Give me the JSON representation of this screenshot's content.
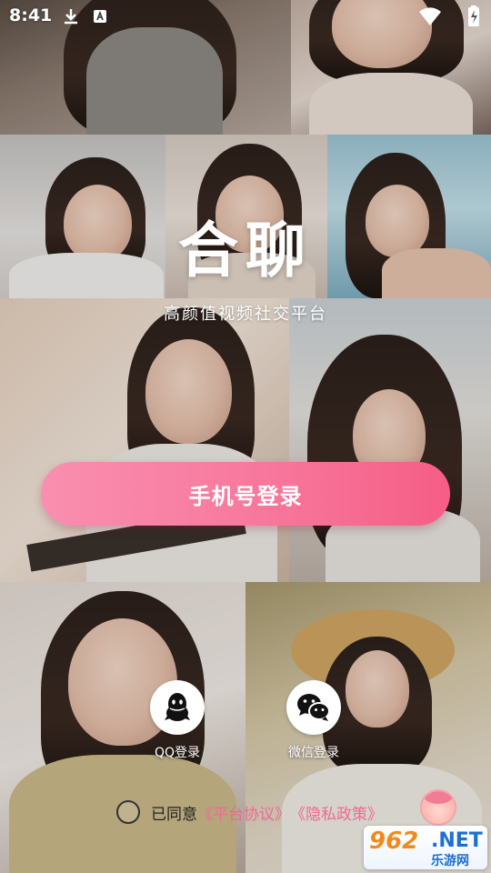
{
  "status_bar": {
    "time": "8:41",
    "icons": [
      "download-icon",
      "accessibility-icon",
      "wifi-icon",
      "battery-icon"
    ]
  },
  "brand": {
    "title": "合聊",
    "slogan": "高颜值视频社交平台"
  },
  "login": {
    "phone_label": "手机号登录",
    "qq_label": "QQ登录",
    "wechat_label": "微信登录"
  },
  "agreement": {
    "prefix": "已同意",
    "platform_link": "《平台协议》",
    "privacy_link": "《隐私政策》"
  },
  "watermark": {
    "number": "962",
    "net": ".NET",
    "site": "乐游网"
  },
  "colors": {
    "accent_pink": "#f8779c",
    "link_pink": "#ee6a93"
  }
}
